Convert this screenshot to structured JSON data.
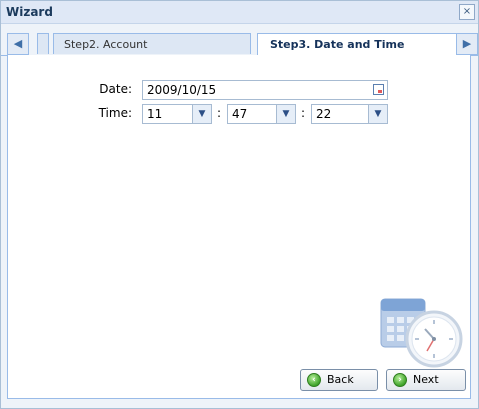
{
  "window": {
    "title": "Wizard",
    "close_label": "×"
  },
  "tabs": [
    {
      "label": "Step2. Account"
    },
    {
      "label": "Step3. Date and Time"
    }
  ],
  "form": {
    "date_label": "Date:",
    "date_value": "2009/10/15",
    "time_label": "Time:",
    "hour": "11",
    "minute": "47",
    "second": "22",
    "separator": ":"
  },
  "buttons": {
    "back": "Back",
    "next": "Next"
  },
  "icons": {
    "tab_prev": "arrow-left-icon",
    "tab_next": "arrow-right-icon",
    "date_picker": "calendar-icon",
    "dropdown": "chevron-down-icon",
    "illustration": "calendar-clock-icon"
  }
}
